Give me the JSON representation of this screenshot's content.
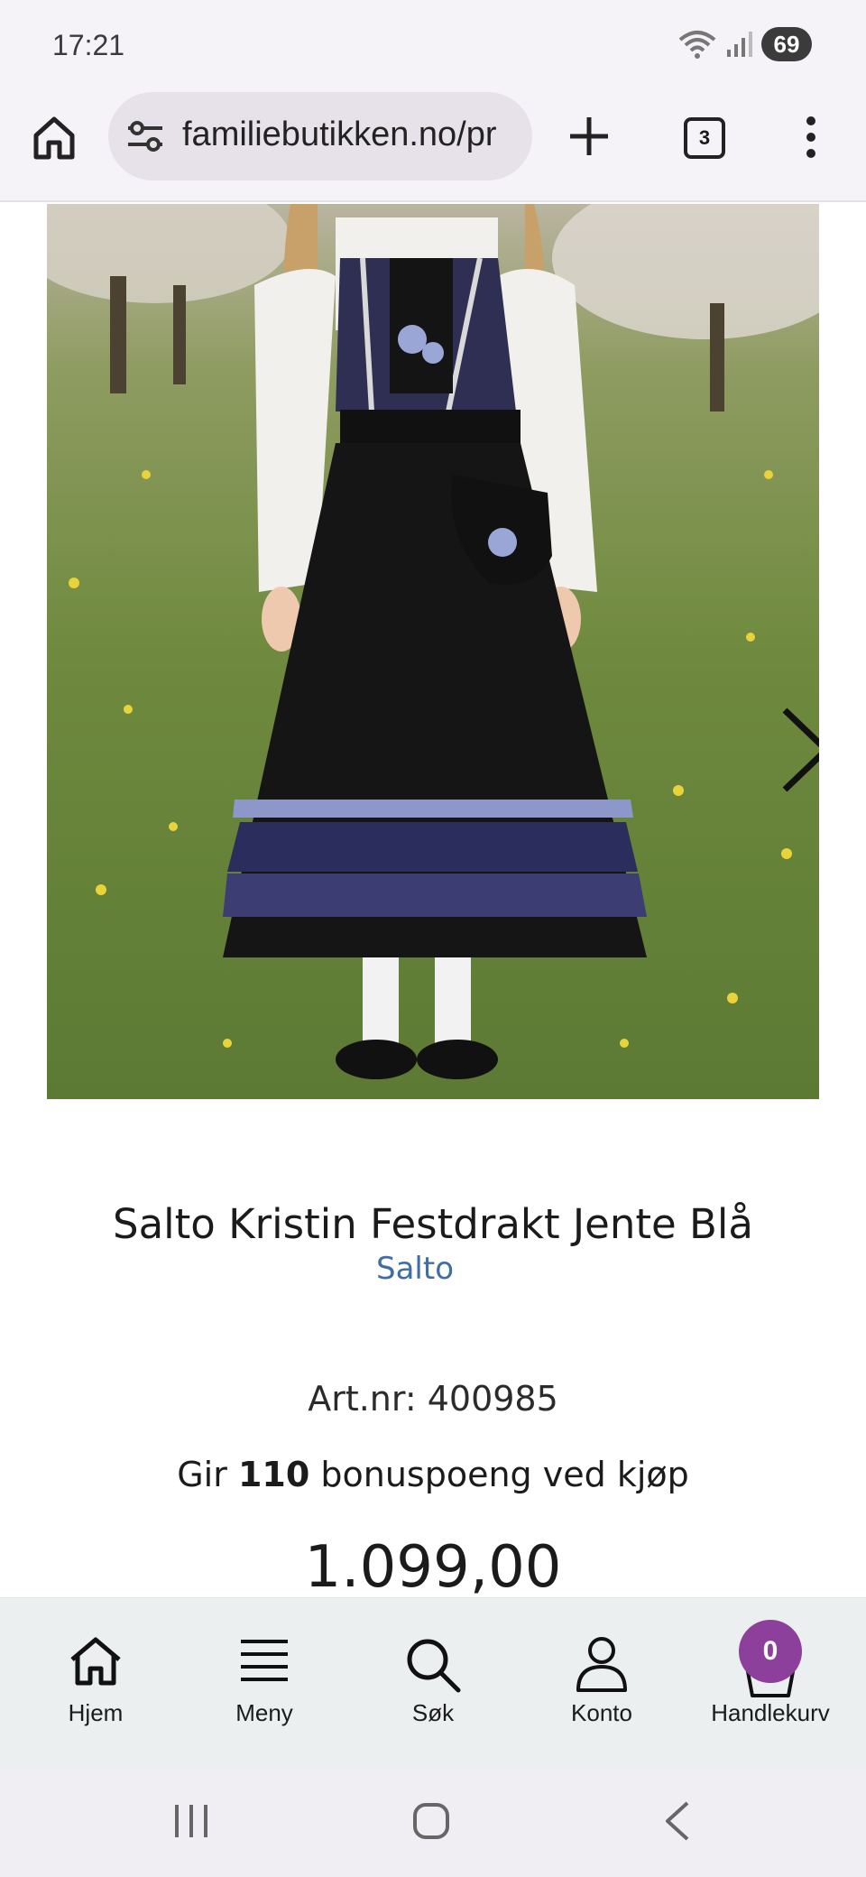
{
  "status_bar": {
    "time": "17:21",
    "battery": "69"
  },
  "browser": {
    "url": "familiebutikken.no/pr",
    "tab_count": "3"
  },
  "product": {
    "title": "Salto Kristin Festdrakt Jente Blå",
    "brand": "Salto",
    "art_nr": "Art.nr: 400985",
    "bonus_prefix": "Gir",
    "bonus_points": "110",
    "bonus_suffix": "bonuspoeng ved kjøp",
    "price": "1.099,00"
  },
  "bottom_nav": {
    "items": [
      {
        "label": "Hjem",
        "icon": "home-icon"
      },
      {
        "label": "Meny",
        "icon": "menu-icon"
      },
      {
        "label": "Søk",
        "icon": "search-icon"
      },
      {
        "label": "Konto",
        "icon": "account-icon"
      },
      {
        "label": "Handlekurv",
        "icon": "basket-icon"
      }
    ],
    "cart_count": "0"
  },
  "colors": {
    "accent_purple": "#8c3f9b",
    "brand_link": "#3f6ea6"
  }
}
